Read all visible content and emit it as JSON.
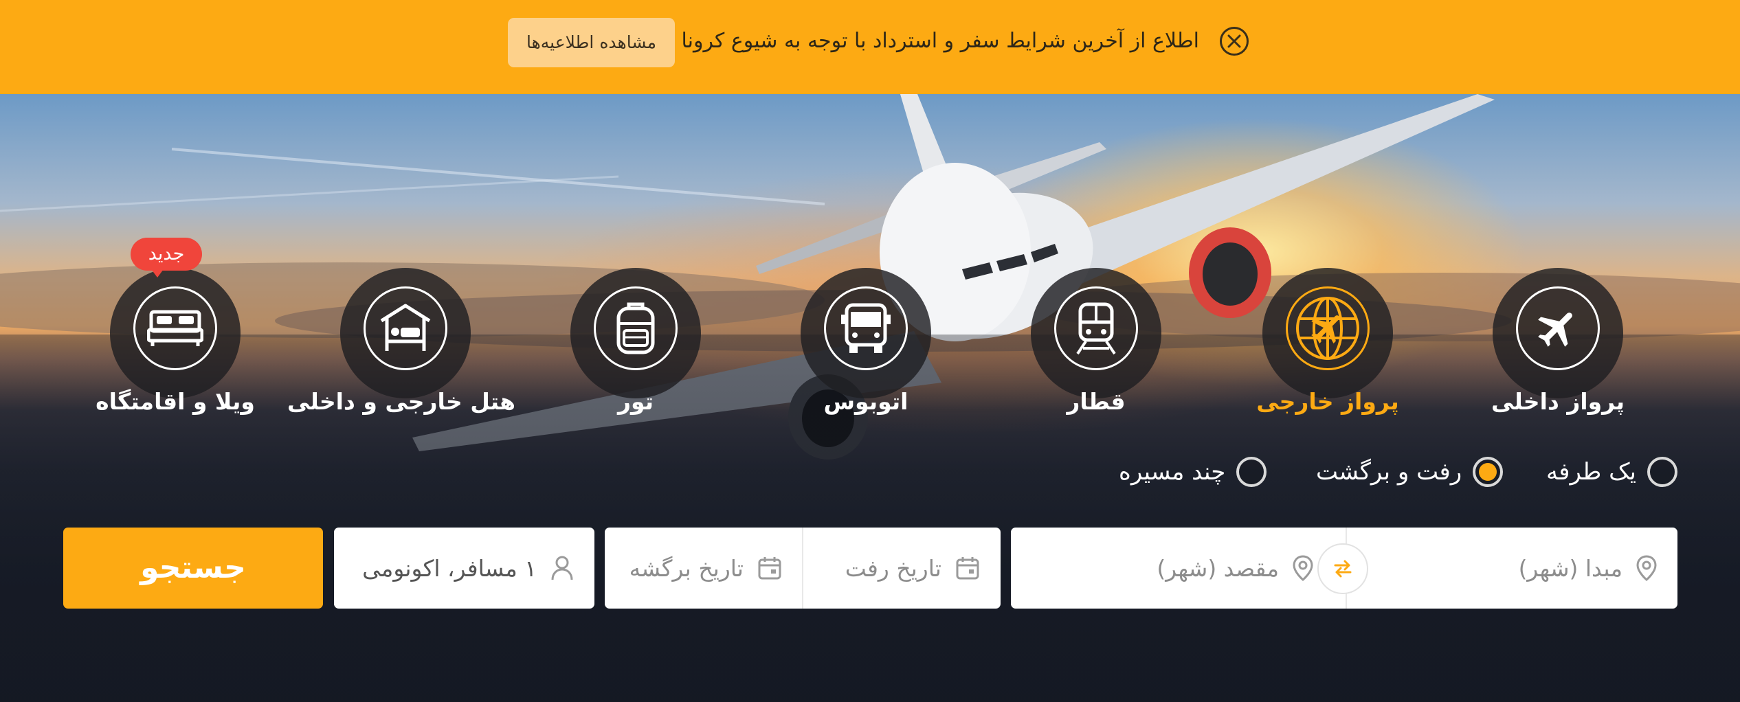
{
  "banner": {
    "text": "اطلاع از آخرین شرایط سفر و استرداد با توجه به شیوع کرونا",
    "button_label": "مشاهده اطلاعیه‌ها",
    "background_color": "#fdaa13"
  },
  "tabs": [
    {
      "label": "پرواز داخلی",
      "icon": "airplane-icon",
      "active": false
    },
    {
      "label": "پرواز خارجی",
      "icon": "globe-airplane-icon",
      "active": true
    },
    {
      "label": "قطار",
      "icon": "train-icon",
      "active": false
    },
    {
      "label": "اتوبوس",
      "icon": "bus-icon",
      "active": false
    },
    {
      "label": "تور",
      "icon": "backpack-icon",
      "active": false
    },
    {
      "label": "هتل خارجی و داخلی",
      "icon": "hotel-icon",
      "active": false
    },
    {
      "label": "ویلا و اقامتگاه",
      "icon": "bed-icon",
      "active": false
    }
  ],
  "new_badge": "جدید",
  "trip_types": [
    {
      "label": "یک طرفه",
      "selected": false
    },
    {
      "label": "رفت و برگشت",
      "selected": true
    },
    {
      "label": "چند مسیره",
      "selected": false
    }
  ],
  "search": {
    "origin_placeholder": "مبدا (شهر)",
    "destination_placeholder": "مقصد (شهر)",
    "depart_date_placeholder": "تاریخ رفت",
    "return_date_placeholder": "تاریخ برگشه",
    "passengers_value": "۱ مسافر، اکونومی",
    "search_button": "جستجو"
  },
  "colors": {
    "accent": "#fdaa13",
    "badge": "#f0453b"
  }
}
